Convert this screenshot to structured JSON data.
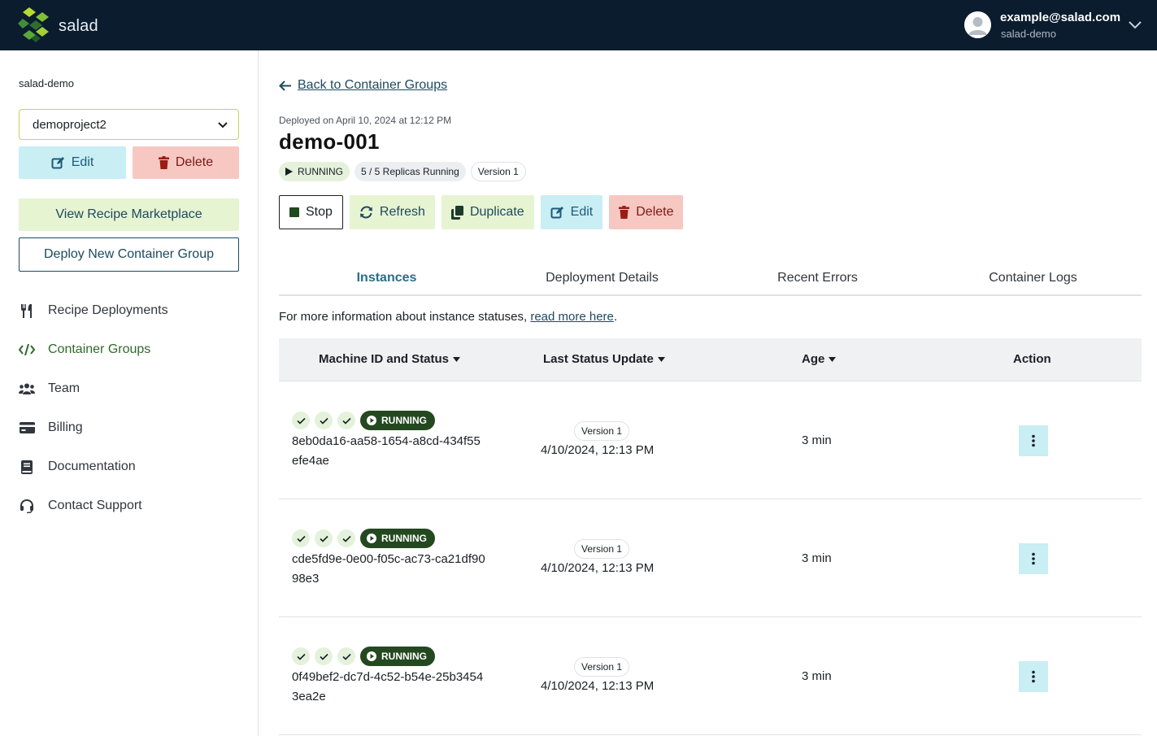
{
  "header": {
    "brand": "salad",
    "user_email": "example@salad.com",
    "user_org": "salad-demo"
  },
  "sidebar": {
    "org_label": "salad-demo",
    "project_value": "demoproject2",
    "edit_label": "Edit",
    "delete_label": "Delete",
    "marketplace_label": "View Recipe Marketplace",
    "deploy_label": "Deploy New Container Group",
    "items": [
      {
        "label": "Recipe Deployments",
        "icon": "utensils-icon"
      },
      {
        "label": "Container Groups",
        "icon": "code-icon"
      },
      {
        "label": "Team",
        "icon": "team-icon"
      },
      {
        "label": "Billing",
        "icon": "credit-card-icon"
      },
      {
        "label": "Documentation",
        "icon": "book-icon"
      },
      {
        "label": "Contact Support",
        "icon": "headset-icon"
      }
    ]
  },
  "main": {
    "back_label": "Back to Container Groups",
    "deployed_text": "Deployed on April 10, 2024 at 12:12 PM",
    "title": "demo-001",
    "status_badge": "RUNNING",
    "replicas_badge": "5 / 5 Replicas Running",
    "version_badge": "Version 1",
    "actions": {
      "stop": "Stop",
      "refresh": "Refresh",
      "duplicate": "Duplicate",
      "edit": "Edit",
      "delete": "Delete"
    },
    "tabs": [
      "Instances",
      "Deployment Details",
      "Recent Errors",
      "Container Logs"
    ],
    "info_prefix": "For more information about instance statuses, ",
    "info_link": "read more here",
    "info_suffix": ".",
    "table": {
      "headers": [
        "Machine ID and Status",
        "Last Status Update",
        "Age",
        "Action"
      ],
      "rows": [
        {
          "status": "RUNNING",
          "machine_id": "8eb0da16-aa58-1654-a8cd-434f55efe4ae",
          "version": "Version 1",
          "updated": "4/10/2024, 12:13 PM",
          "age": "3 min"
        },
        {
          "status": "RUNNING",
          "machine_id": "cde5fd9e-0e00-f05c-ac73-ca21df9098e3",
          "version": "Version 1",
          "updated": "4/10/2024, 12:13 PM",
          "age": "3 min"
        },
        {
          "status": "RUNNING",
          "machine_id": "0f49bef2-dc7d-4c52-b54e-25b34543ea2e",
          "version": "Version 1",
          "updated": "4/10/2024, 12:13 PM",
          "age": "3 min"
        }
      ]
    }
  },
  "colors": {
    "topbar": "#0b1c2e",
    "running_pill": "#24481f",
    "accent_green": "#2f6b2a",
    "accent_blue": "#2a6d8a"
  }
}
